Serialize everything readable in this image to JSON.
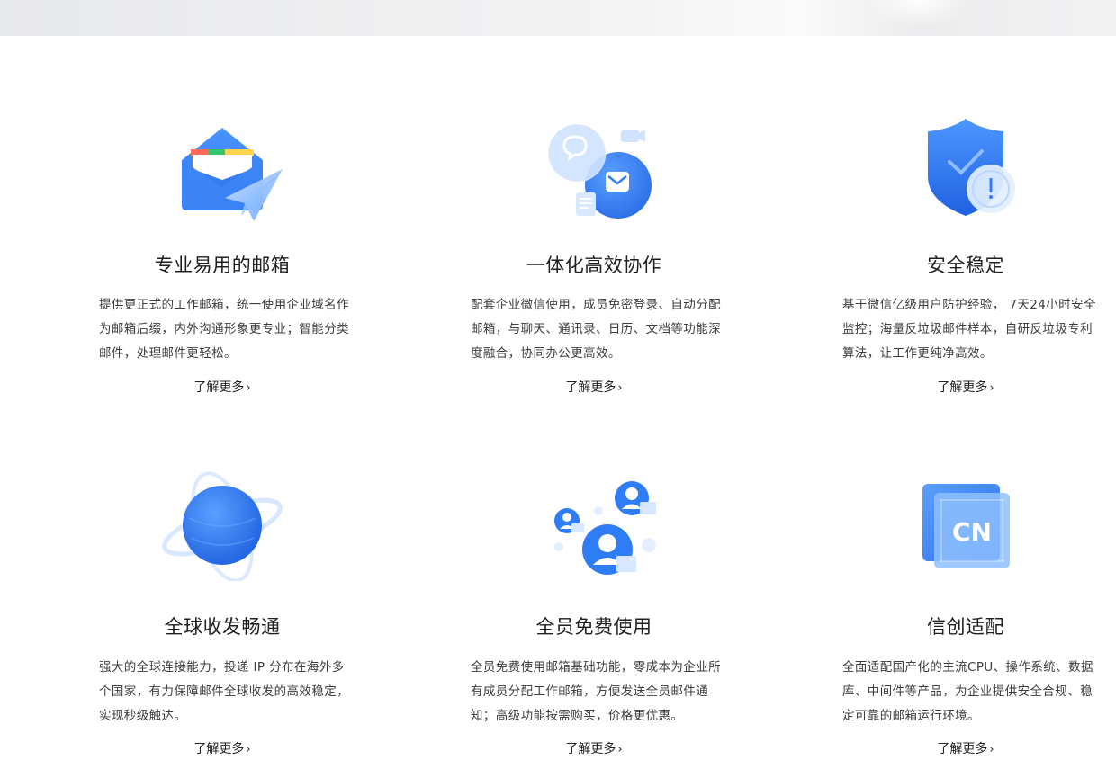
{
  "features": [
    {
      "icon": "mail-send-icon",
      "title": "专业易用的邮箱",
      "desc": "提供更正式的工作邮箱，统一使用企业域名作为邮箱后缀，内外沟通形象更专业；智能分类邮件，处理邮件更轻松。",
      "more": "了解更多"
    },
    {
      "icon": "collaboration-icon",
      "title": "一体化高效协作",
      "desc": "配套企业微信使用，成员免密登录、自动分配邮箱，与聊天、通讯录、日历、文档等功能深度融合，协同办公更高效。",
      "more": "了解更多"
    },
    {
      "icon": "shield-icon",
      "title": "安全稳定",
      "desc": "基于微信亿级用户防护经验， 7天24小时安全监控；海量反垃圾邮件样本，自研反垃圾专利算法，让工作更纯净高效。",
      "more": "了解更多"
    },
    {
      "icon": "globe-icon",
      "title": "全球收发畅通",
      "desc": "强大的全球连接能力，投递 IP 分布在海外多个国家，有力保障邮件全球收发的高效稳定，实现秒级触达。",
      "more": "了解更多"
    },
    {
      "icon": "users-icon",
      "title": "全员免费使用",
      "desc": "全员免费使用邮箱基础功能，零成本为企业所有成员分配工作邮箱，方便发送全员邮件通知；高级功能按需购买，价格更优惠。",
      "more": "了解更多"
    },
    {
      "icon": "cn-chip-icon",
      "chip_text": "CN",
      "title": "信创适配",
      "desc": "全面适配国产化的主流CPU、操作系统、数据库、中间件等产品，为企业提供安全合规、稳定可靠的邮箱运行环境。",
      "more": "了解更多"
    }
  ],
  "colors": {
    "primary_blue": "#2f7df6",
    "light_blue": "#d6e7ff"
  }
}
